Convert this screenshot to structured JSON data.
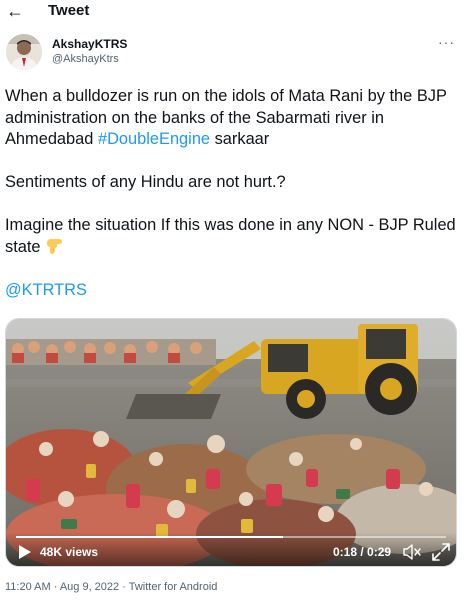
{
  "header": {
    "title": "Tweet",
    "back_icon": "back-arrow-icon"
  },
  "author": {
    "name": "AkshayKTRS",
    "handle": "@AkshayKtrs"
  },
  "tweet": {
    "line1_pre": "When a bulldozer is run on the idols of Mata Rani by the BJP administration on the banks of the Sabarmati river in Ahmedabad ",
    "hashtag": "#DoubleEngine",
    "line1_post": " sarkaar",
    "line2": "Sentiments of any Hindu are not hurt.?",
    "line3": "Imagine the situation If this was done in any NON - BJP Ruled state ",
    "line3_emoji": "backhand-index-pointing-down-emoji",
    "mention": "@KTRTRS"
  },
  "video": {
    "views": "48K views",
    "time": "0:18 / 0:29",
    "progress": 0.62,
    "icons": [
      "play-icon",
      "mute-icon",
      "fullscreen-icon"
    ]
  },
  "meta": {
    "timestamp": "11:20 AM · Aug 9, 2022 · Twitter for Android"
  },
  "colors": {
    "accent": "#1d9bf0",
    "text": "#0f1419",
    "secondary": "#536471"
  }
}
